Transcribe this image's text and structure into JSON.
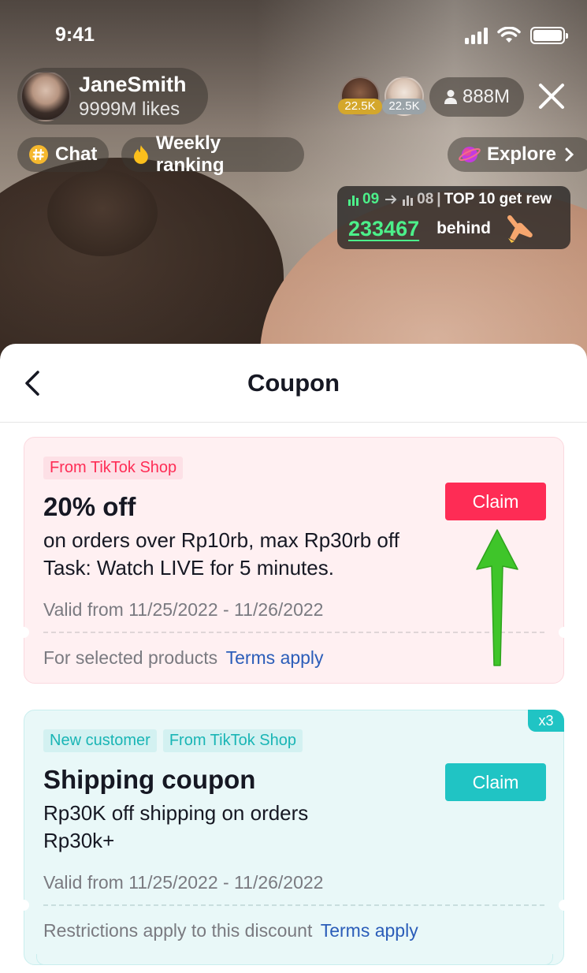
{
  "status_bar": {
    "time": "9:41"
  },
  "host": {
    "name": "JaneSmith",
    "likes": "9999M likes"
  },
  "viewers": [
    {
      "badge": "22.5K",
      "badge_color": "#d4a72c"
    },
    {
      "badge": "22.5K",
      "badge_color": "#9aa3a8"
    }
  ],
  "viewer_count": "888M",
  "pills": {
    "chat": "Chat",
    "weekly_ranking": "Weekly ranking",
    "explore": "Explore"
  },
  "ranking": {
    "from_rank": "09",
    "to_rank": "08",
    "headline": "TOP 10 get rew",
    "points": "233467",
    "behind": "behind"
  },
  "sheet": {
    "title": "Coupon"
  },
  "coupons": [
    {
      "tags": [
        "From TikTok Shop"
      ],
      "title": "20% off",
      "description": "on orders over Rp10rb, max Rp30rb off\nTask: Watch LIVE for 5 minutes.",
      "valid": "Valid from 11/25/2022 - 11/26/2022",
      "footer": "For selected products",
      "terms": "Terms apply",
      "claim": "Claim",
      "accent": "#fe2c55"
    },
    {
      "tags": [
        "New customer",
        "From TikTok Shop"
      ],
      "title": "Shipping coupon",
      "description": "Rp30K off shipping on orders Rp30k+",
      "valid": "Valid from 11/25/2022 - 11/26/2022",
      "footer": "Restrictions apply to this discount",
      "terms": "Terms apply",
      "claim": "Claim",
      "count": "x3",
      "accent": "#20c4c4"
    }
  ],
  "colors": {
    "red_accent": "#fe2c55",
    "cyan_accent": "#20c4c4",
    "link_blue": "#2b5db9",
    "ranking_green": "#4cf08a",
    "annotation_arrow": "#3fc52a"
  }
}
